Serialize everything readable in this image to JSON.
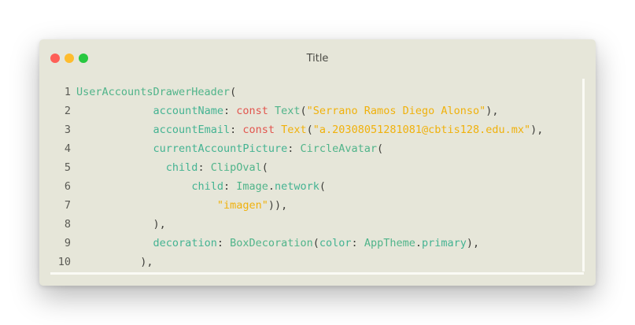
{
  "window": {
    "title": "Title"
  },
  "colors": {
    "background": "#e6e6d9",
    "class": "#50b48a",
    "property": "#44b392",
    "keyword": "#e2564f",
    "string": "#f0b10c",
    "punctuation": "#3e3e3a"
  },
  "code": {
    "lines": [
      {
        "n": "1",
        "tokens": [
          {
            "t": "UserAccountsDrawerHeader",
            "c": "class"
          },
          {
            "t": "(",
            "c": "punc"
          }
        ]
      },
      {
        "n": "2",
        "tokens": [
          {
            "t": "            ",
            "c": "punc"
          },
          {
            "t": "accountName",
            "c": "prop"
          },
          {
            "t": ": ",
            "c": "punc"
          },
          {
            "t": "const ",
            "c": "kw"
          },
          {
            "t": "Text",
            "c": "class"
          },
          {
            "t": "(",
            "c": "punc"
          },
          {
            "t": "\"Serrano Ramos Diego Alonso\"",
            "c": "str"
          },
          {
            "t": "),",
            "c": "punc"
          }
        ]
      },
      {
        "n": "3",
        "tokens": [
          {
            "t": "            ",
            "c": "punc"
          },
          {
            "t": "accountEmail",
            "c": "prop"
          },
          {
            "t": ": ",
            "c": "punc"
          },
          {
            "t": "const ",
            "c": "kw"
          },
          {
            "t": "Text",
            "c": "str"
          },
          {
            "t": "(",
            "c": "punc"
          },
          {
            "t": "\"a.20308051281081@cbtis128.edu.mx\"",
            "c": "str"
          },
          {
            "t": "),",
            "c": "punc"
          }
        ]
      },
      {
        "n": "4",
        "tokens": [
          {
            "t": "            ",
            "c": "punc"
          },
          {
            "t": "currentAccountPicture",
            "c": "prop"
          },
          {
            "t": ": ",
            "c": "punc"
          },
          {
            "t": "CircleAvatar",
            "c": "class"
          },
          {
            "t": "(",
            "c": "punc"
          }
        ]
      },
      {
        "n": "5",
        "tokens": [
          {
            "t": "              ",
            "c": "punc"
          },
          {
            "t": "child",
            "c": "prop"
          },
          {
            "t": ": ",
            "c": "punc"
          },
          {
            "t": "ClipOval",
            "c": "class"
          },
          {
            "t": "(",
            "c": "punc"
          }
        ]
      },
      {
        "n": "6",
        "tokens": [
          {
            "t": "                  ",
            "c": "punc"
          },
          {
            "t": "child",
            "c": "prop"
          },
          {
            "t": ": ",
            "c": "punc"
          },
          {
            "t": "Image",
            "c": "class"
          },
          {
            "t": ".",
            "c": "dot"
          },
          {
            "t": "network",
            "c": "prop"
          },
          {
            "t": "(",
            "c": "punc"
          }
        ]
      },
      {
        "n": "7",
        "tokens": [
          {
            "t": "                      ",
            "c": "punc"
          },
          {
            "t": "\"imagen\"",
            "c": "str"
          },
          {
            "t": ")),",
            "c": "punc"
          }
        ]
      },
      {
        "n": "8",
        "tokens": [
          {
            "t": "            ",
            "c": "punc"
          },
          {
            "t": "),",
            "c": "punc"
          }
        ]
      },
      {
        "n": "9",
        "tokens": [
          {
            "t": "            ",
            "c": "punc"
          },
          {
            "t": "decoration",
            "c": "prop"
          },
          {
            "t": ": ",
            "c": "punc"
          },
          {
            "t": "BoxDecoration",
            "c": "class"
          },
          {
            "t": "(",
            "c": "punc"
          },
          {
            "t": "color",
            "c": "prop"
          },
          {
            "t": ": ",
            "c": "punc"
          },
          {
            "t": "AppTheme",
            "c": "class"
          },
          {
            "t": ".",
            "c": "dot"
          },
          {
            "t": "primary",
            "c": "prop"
          },
          {
            "t": "),",
            "c": "punc"
          }
        ]
      },
      {
        "n": "10",
        "tokens": [
          {
            "t": "          ",
            "c": "punc"
          },
          {
            "t": "),",
            "c": "punc"
          }
        ]
      }
    ]
  }
}
